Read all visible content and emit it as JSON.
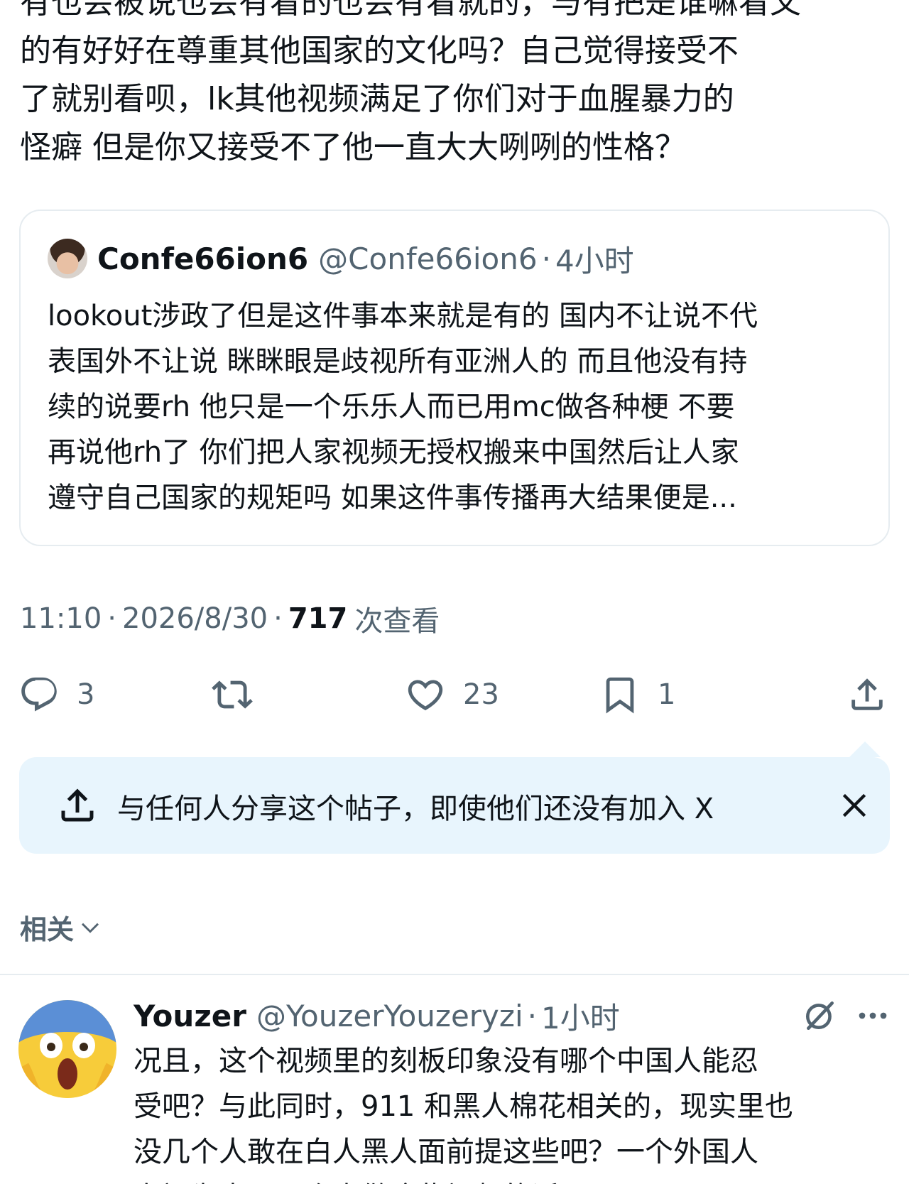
{
  "post": {
    "text_lines": "有也会被说也会有看的也会有看就的，与有把是谁嘛看文\n的有好好在尊重其他国家的文化吗？自己觉得接受不\n了就别看呗，lk其他视频满足了你们对于血腥暴力的\n怪癖 但是你又接受不了他一直大大咧咧的性格？"
  },
  "quote": {
    "name": "Confe66ion6",
    "handle": "@Confe66ion6",
    "separator": "·",
    "time": "4小时",
    "text": "lookout涉政了但是这件事本来就是有的 国内不让说不代\n表国外不让说 眯眯眼是歧视所有亚洲人的 而且他没有持\n续的说要rh 他只是一个乐乐人而已用mc做各种梗 不要\n再说他rh了 你们把人家视频无授权搬来中国然后让人家\n遵守自己国家的规矩吗 如果这件事传播再大结果便是..."
  },
  "meta": {
    "time": "11:10",
    "date": "2026/8/30",
    "separator": "·",
    "views_count": "717",
    "views_label": "次查看"
  },
  "actions": {
    "reply_count": "3",
    "like_count": "23",
    "bookmark_count": "1"
  },
  "share_banner": {
    "text": "与任何人分享这个帖子，即使他们还没有加入 X"
  },
  "related": {
    "label": "相关"
  },
  "reply": {
    "name": "Youzer",
    "handle": "@YouzerYouzeryzi",
    "separator": "·",
    "time": "1小时",
    "text": "况且，这个视频里的刻板印象没有哪个中国人能忍\n受吧？与此同时，911 和黑人棉花相关的，现实里也\n没几个人敢在白人黑人面前提这些吧？一个外国人\n专门为中国观众来做这些视频的话，"
  },
  "colors": {
    "text": "#0f1419",
    "muted": "#536471",
    "border": "#e6ecf0",
    "banner_bg": "#e8f5fd"
  }
}
